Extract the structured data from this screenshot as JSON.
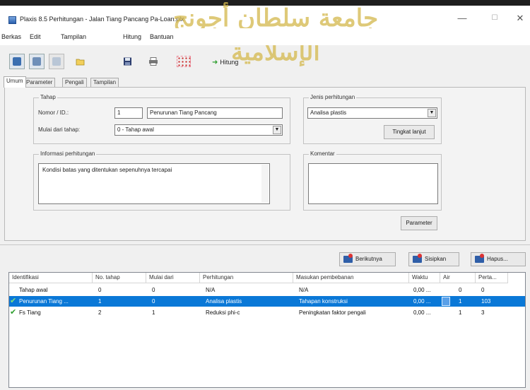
{
  "window": {
    "title": "Plaxis 8.5 Perhitungan - Jalan Tiang Pancang Pa-Loan.plx",
    "minimize": "—",
    "maximize": "☐",
    "close": "✕",
    "watermark": "جامعة سلطان أجونج الإسلامية"
  },
  "menu": [
    "Berkas",
    "Edit",
    "Tampilan",
    "Hitung",
    "Bantuan"
  ],
  "toolbar": {
    "hitung_label": "Hitung"
  },
  "tabs": [
    "Umum",
    "Parameter",
    "Pengali",
    "Tampilan"
  ],
  "tahap": {
    "group_title": "Tahap",
    "nomor_label": "Nomor / ID.:",
    "nomor_value": "1",
    "id_value": "Penurunan Tiang Pancang",
    "mulai_label": "Mulai dari tahap:",
    "mulai_value": "0 - Tahap awal"
  },
  "jenis": {
    "group_title": "Jenis perhitungan",
    "value": "Analisa plastis",
    "tingkat_button": "Tingkat lanjut"
  },
  "informasi": {
    "group_title": "Informasi perhitungan",
    "text": "Kondisi batas yang ditentukan sepenuhnya tercapai"
  },
  "komentar": {
    "group_title": "Komentar",
    "text": ""
  },
  "parameter_button": "Parameter",
  "actions": {
    "berikutnya": "Berikutnya",
    "sisipkan": "Sisipkan",
    "hapus": "Hapus..."
  },
  "table": {
    "columns": [
      "Identifikasi",
      "No. tahap",
      "Mulai dari",
      "Perhitungan",
      "Masukan pembebanan",
      "Waktu",
      "Air",
      "Perta..."
    ],
    "rows": [
      {
        "checked": false,
        "selected": false,
        "cells": [
          "Tahap awal",
          "0",
          "0",
          "N/A",
          "N/A",
          "0,00 ...",
          "0",
          "0"
        ]
      },
      {
        "checked": true,
        "selected": true,
        "cells": [
          "Penurunan Tiang ...",
          "1",
          "0",
          "Analisa plastis",
          "Tahapan konstruksi",
          "0,00 ...",
          "1",
          "103"
        ]
      },
      {
        "checked": true,
        "selected": false,
        "cells": [
          "Fs Tiang",
          "2",
          "1",
          "Reduksi phi-c",
          "Peningkatan faktor pengali",
          "0,00 ...",
          "1",
          "3"
        ]
      }
    ]
  }
}
